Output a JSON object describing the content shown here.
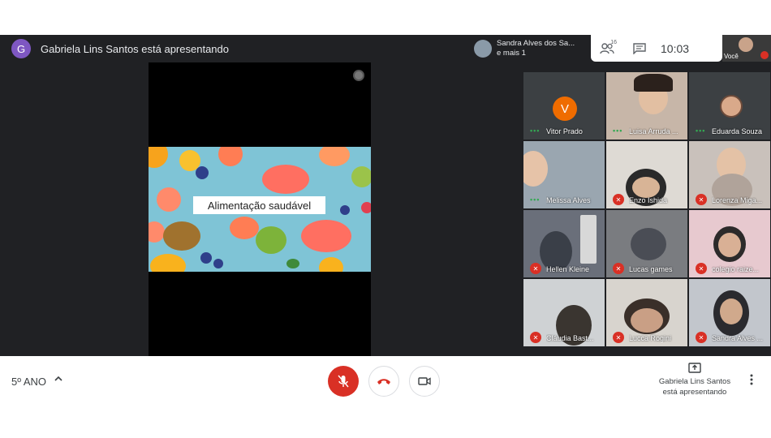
{
  "presenter": {
    "avatar_letter": "G",
    "text": "Gabriela Lins Santos está apresentando"
  },
  "slide": {
    "title": "Alimentação saudável"
  },
  "top_chip": {
    "line1": "Sandra Alves dos Sa...",
    "line2": "e mais 1",
    "people_count": "16",
    "clock": "10:03",
    "self_label": "Você"
  },
  "participants": [
    {
      "name": "Vitor Prado",
      "avatar": "V",
      "status": "speaking"
    },
    {
      "name": "Luisa Arruda ...",
      "status": "speaking"
    },
    {
      "name": "Eduarda Souza",
      "status": "speaking"
    },
    {
      "name": "Melissa Alves",
      "status": "speaking"
    },
    {
      "name": "Enzo Ishida",
      "status": "muted"
    },
    {
      "name": "Lorenza Miga...",
      "status": "muted"
    },
    {
      "name": "Hellen Kleine",
      "status": "muted"
    },
    {
      "name": "Lucas games",
      "status": "muted"
    },
    {
      "name": "colegio raize...",
      "status": "muted"
    },
    {
      "name": "Cláudia Bast...",
      "status": "muted"
    },
    {
      "name": "Lucca Rogini",
      "status": "muted"
    },
    {
      "name": "Sandra Alves ...",
      "status": "muted"
    }
  ],
  "bottom": {
    "meeting_title": "5º ANO",
    "present_line1": "Gabriela Lins Santos",
    "present_line2": "está apresentando"
  },
  "colors": {
    "accent_red": "#d93025",
    "speaking_green": "#34a853",
    "dark_bg": "#202124"
  }
}
